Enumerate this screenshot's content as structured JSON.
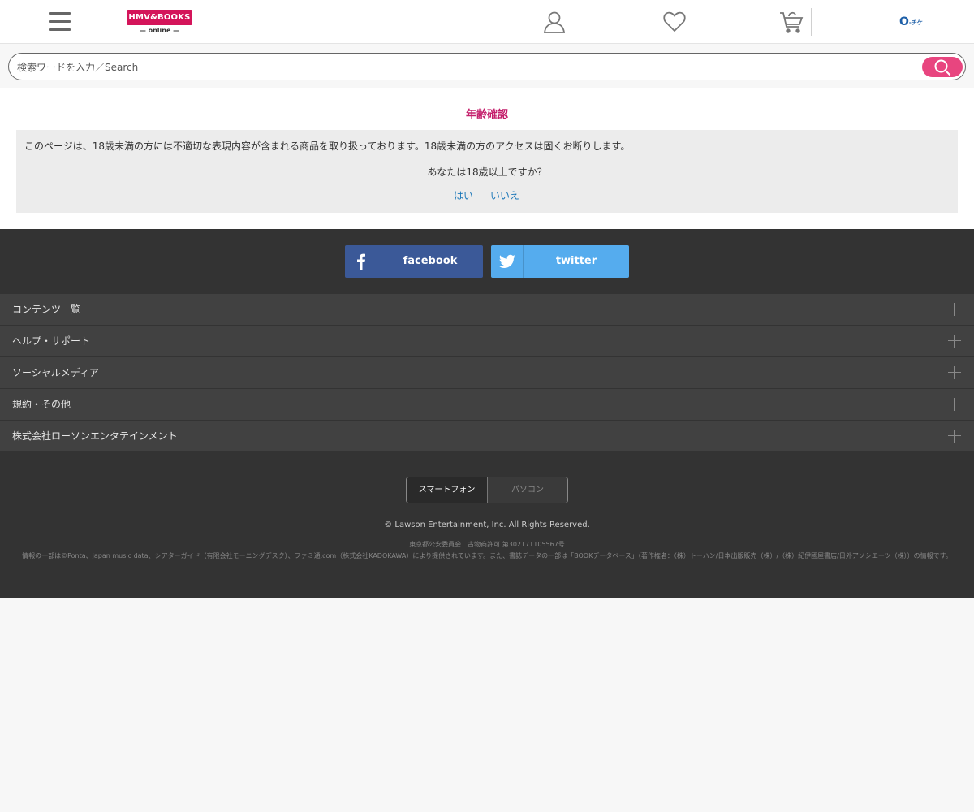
{
  "header": {
    "logo_top": "HMV&BOOKS",
    "logo_bottom": "— online —",
    "ponta_main": "O",
    "ponta_small": "-チケ"
  },
  "search": {
    "placeholder": "検索ワードを入力／Search"
  },
  "age_check": {
    "title": "年齢確認",
    "notice": "このページは、18歳未満の方には不適切な表現内容が含まれる商品を取り扱っております。18歳未満の方のアクセスは固くお断りします。",
    "question": "あなたは18歳以上ですか？",
    "yes_label": "はい",
    "no_label": "いいえ"
  },
  "social": {
    "facebook_label": "facebook",
    "twitter_label": "twitter"
  },
  "accordion": [
    {
      "label": "コンテンツ一覧"
    },
    {
      "label": "ヘルプ・サポート"
    },
    {
      "label": "ソーシャルメディア"
    },
    {
      "label": "規約・その他"
    },
    {
      "label": "株式会社ローソンエンタテインメント"
    }
  ],
  "view_toggle": {
    "smartphone": "スマートフォン",
    "pc": "パソコン"
  },
  "footer": {
    "copyright": "© Lawson Entertainment, Inc. All Rights Reserved.",
    "license": "東京都公安委員会　古物商許可 第302171105567号",
    "credits": "情報の一部は©Ponta、japan music data、シアターガイド（有限会社モーニングデスク）、ファミ通.com（株式会社KADOKAWA）により提供されています。また、書誌データの一部は「BOOKデータベース」（著作権者：（株）トーハン/日本出版販売（株）/（株）紀伊國屋書店/日外アソシエーツ（株））の情報です。"
  },
  "colors": {
    "brand_pink": "#d4145a",
    "search_button": "#e8457f",
    "title_pink": "#c41f6b",
    "link_blue": "#1976b8",
    "facebook": "#3b5998",
    "twitter": "#55acee",
    "footer_bg": "#333333"
  },
  "icons": {
    "menu": "hamburger-icon",
    "account": "user-icon",
    "favorites": "heart-icon",
    "cart": "cart-icon",
    "search": "search-icon",
    "facebook": "facebook-icon",
    "twitter": "twitter-icon",
    "expand": "plus-icon"
  }
}
